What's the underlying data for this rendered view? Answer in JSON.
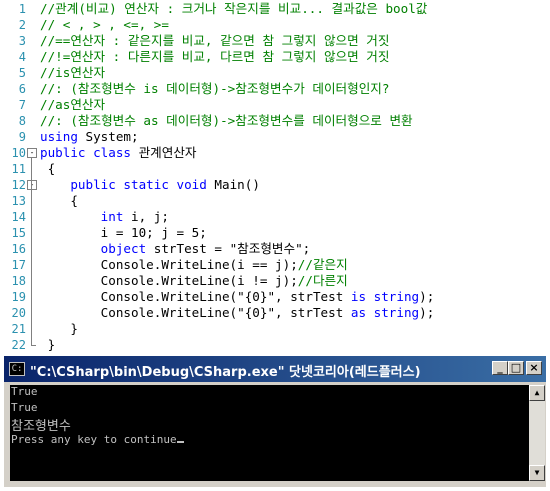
{
  "editor": {
    "lines": [
      {
        "num": "1",
        "segs": [
          {
            "t": "//관계(비교) 연산자 : 크거나 작은지를 비교... 결과값은 bool값",
            "c": "cmt"
          }
        ]
      },
      {
        "num": "2",
        "segs": [
          {
            "t": "// < , > , <=, >=",
            "c": "cmt"
          }
        ]
      },
      {
        "num": "3",
        "segs": [
          {
            "t": "//==연산자 : 같은지를 비교, 같으면 참 그렇지 않으면 거짓",
            "c": "cmt"
          }
        ]
      },
      {
        "num": "4",
        "segs": [
          {
            "t": "//!=연산자 : 다른지를 비교, 다르면 참 그렇지 않으면 거짓",
            "c": "cmt"
          }
        ]
      },
      {
        "num": "5",
        "segs": [
          {
            "t": "//is연산자",
            "c": "cmt"
          }
        ]
      },
      {
        "num": "6",
        "segs": [
          {
            "t": "//: (참조형변수 is 데이터형)->참조형변수가 데이터형인지?",
            "c": "cmt"
          }
        ]
      },
      {
        "num": "7",
        "segs": [
          {
            "t": "//as연산자",
            "c": "cmt"
          }
        ]
      },
      {
        "num": "8",
        "segs": [
          {
            "t": "//: (참조형변수 as 데이터형)->참조형변수를 데이터형으로 변환",
            "c": "cmt"
          }
        ]
      },
      {
        "num": "9",
        "segs": [
          {
            "t": "using",
            "c": "kw"
          },
          {
            "t": " System;",
            "c": "txt"
          }
        ]
      },
      {
        "num": "10",
        "fold": "⊟",
        "segs": [
          {
            "t": "public class",
            "c": "kw"
          },
          {
            "t": " 관계연산자",
            "c": "txt"
          }
        ]
      },
      {
        "num": "11",
        "segs": [
          {
            "t": " {",
            "c": "txt"
          }
        ]
      },
      {
        "num": "12",
        "fold": "⊟",
        "segs": [
          {
            "t": "    ",
            "c": "txt"
          },
          {
            "t": "public static void",
            "c": "kw"
          },
          {
            "t": " Main()",
            "c": "txt"
          }
        ]
      },
      {
        "num": "13",
        "segs": [
          {
            "t": "    {",
            "c": "txt"
          }
        ]
      },
      {
        "num": "14",
        "segs": [
          {
            "t": "        ",
            "c": "txt"
          },
          {
            "t": "int",
            "c": "kw"
          },
          {
            "t": " i, j;",
            "c": "txt"
          }
        ]
      },
      {
        "num": "15",
        "segs": [
          {
            "t": "        i = 10; j = 5;",
            "c": "txt"
          }
        ]
      },
      {
        "num": "16",
        "segs": [
          {
            "t": "        ",
            "c": "txt"
          },
          {
            "t": "object",
            "c": "kw"
          },
          {
            "t": " strTest = \"참조형변수\";",
            "c": "txt"
          }
        ]
      },
      {
        "num": "17",
        "segs": [
          {
            "t": "        Console.WriteLine(i == j);",
            "c": "txt"
          },
          {
            "t": "//같은지",
            "c": "cmt"
          }
        ]
      },
      {
        "num": "18",
        "segs": [
          {
            "t": "        Console.WriteLine(i != j);",
            "c": "txt"
          },
          {
            "t": "//다른지",
            "c": "cmt"
          }
        ]
      },
      {
        "num": "19",
        "segs": [
          {
            "t": "        Console.WriteLine(\"{0}\", strTest ",
            "c": "txt"
          },
          {
            "t": "is string",
            "c": "kw"
          },
          {
            "t": ");",
            "c": "txt"
          }
        ]
      },
      {
        "num": "20",
        "segs": [
          {
            "t": "        Console.WriteLine(\"{0}\", strTest ",
            "c": "txt"
          },
          {
            "t": "as string",
            "c": "kw"
          },
          {
            "t": ");",
            "c": "txt"
          }
        ]
      },
      {
        "num": "21",
        "segs": [
          {
            "t": "    }",
            "c": "txt"
          }
        ]
      },
      {
        "num": "22",
        "segs": [
          {
            "t": " }",
            "c": "txt"
          }
        ]
      }
    ]
  },
  "console": {
    "title": "\"C:\\CSharp\\bin\\Debug\\CSharp.exe\" 닷넷코리아(레드플러스)",
    "buttons": {
      "minimize": "_",
      "maximize": "□",
      "close": "×"
    },
    "output": [
      "True",
      "True",
      "참조형변수",
      "Press any key to continue"
    ]
  }
}
